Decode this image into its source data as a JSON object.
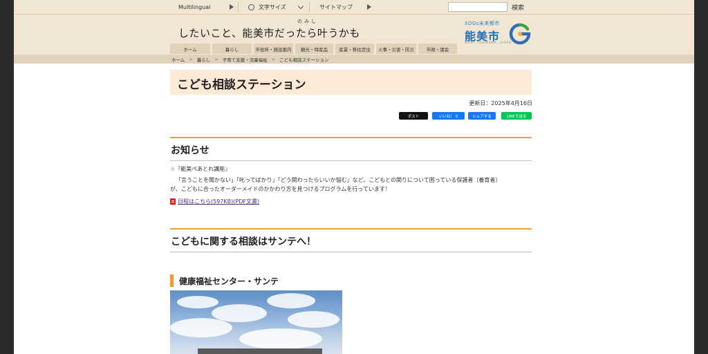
{
  "utility_bar": {
    "multilingual": "Multilingual",
    "font_size": "文字サイズ",
    "sitemap": "サイトマップ",
    "search_placeholder": "",
    "search_button": "検索"
  },
  "header": {
    "tagline": "したいこと、能美市だったら叶うかも",
    "ruby": "のみし",
    "logo_sdgs": "SDGs未来都市",
    "logo_name": "能美市",
    "logo_roman": "NOMI, ISHIKAWA, JAPAN"
  },
  "nav": {
    "items": [
      "ホーム",
      "暮らし",
      "市役所・施設案内",
      "観光・特産品",
      "産業・移住定住",
      "火事・災害・防災",
      "市政・議会"
    ]
  },
  "breadcrumb": [
    "ホーム",
    "暮らし",
    "子育て支援・児童福祉",
    "こども相談ステーション"
  ],
  "page": {
    "title": "こども相談ステーション",
    "updated": "更新日：2025年4月16日"
  },
  "share": {
    "x": "ポスト",
    "fb_like": "いいね！ 0",
    "fb_share": "シェアする",
    "line": "LINEで送る"
  },
  "notice": {
    "heading": "お知らせ",
    "item_title": "☆『能美ぺあとれ講座』",
    "body_line1": "「言うことを聞かない」「叱ってばかり」「どう関わったらいいか悩む」など、こどもとの関りについて困っている保護者（養育者）",
    "body_line2": "が、こどもに合ったオーダーメイドのかかわり方を見つけるプログラムを行っています！",
    "pdf_link": "日程はこちら(597KB)(PDF文書)"
  },
  "consult": {
    "heading": "こどもに関する相談はサンテへ！",
    "facility": "健康福祉センター・サンテ"
  },
  "colors": {
    "accent": "#f29a2e",
    "header_bg": "#f1e6d3",
    "title_bg": "#fce9d6"
  }
}
